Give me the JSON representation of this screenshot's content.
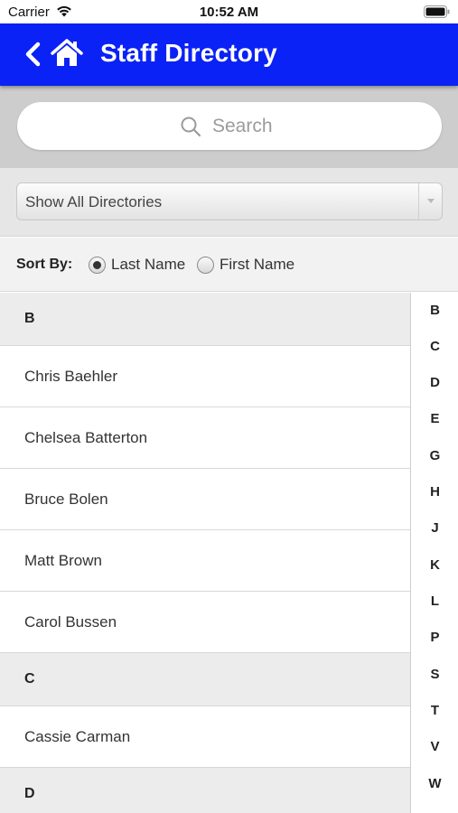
{
  "status_bar": {
    "carrier": "Carrier",
    "time": "10:52 AM",
    "wifi_icon": "wifi-icon",
    "battery_icon": "battery-icon"
  },
  "nav": {
    "title": "Staff Directory",
    "back_icon": "chevron-left-icon",
    "home_icon": "home-icon",
    "background_color": "#0a22f5"
  },
  "search": {
    "placeholder": "Search",
    "value": ""
  },
  "filter": {
    "selected": "Show All Directories"
  },
  "sort": {
    "label": "Sort By:",
    "options": [
      {
        "label": "Last Name",
        "checked": true
      },
      {
        "label": "First Name",
        "checked": false
      }
    ]
  },
  "list": {
    "rows": [
      {
        "type": "header",
        "text": "B"
      },
      {
        "type": "item",
        "text": "Chris Baehler"
      },
      {
        "type": "item",
        "text": "Chelsea Batterton"
      },
      {
        "type": "item",
        "text": "Bruce Bolen"
      },
      {
        "type": "item",
        "text": "Matt Brown"
      },
      {
        "type": "item",
        "text": "Carol Bussen"
      },
      {
        "type": "header",
        "text": "C"
      },
      {
        "type": "item",
        "text": "Cassie Carman"
      },
      {
        "type": "header",
        "text": "D"
      }
    ]
  },
  "index_letters": [
    "B",
    "C",
    "D",
    "E",
    "G",
    "H",
    "J",
    "K",
    "L",
    "P",
    "S",
    "T",
    "V",
    "W"
  ]
}
